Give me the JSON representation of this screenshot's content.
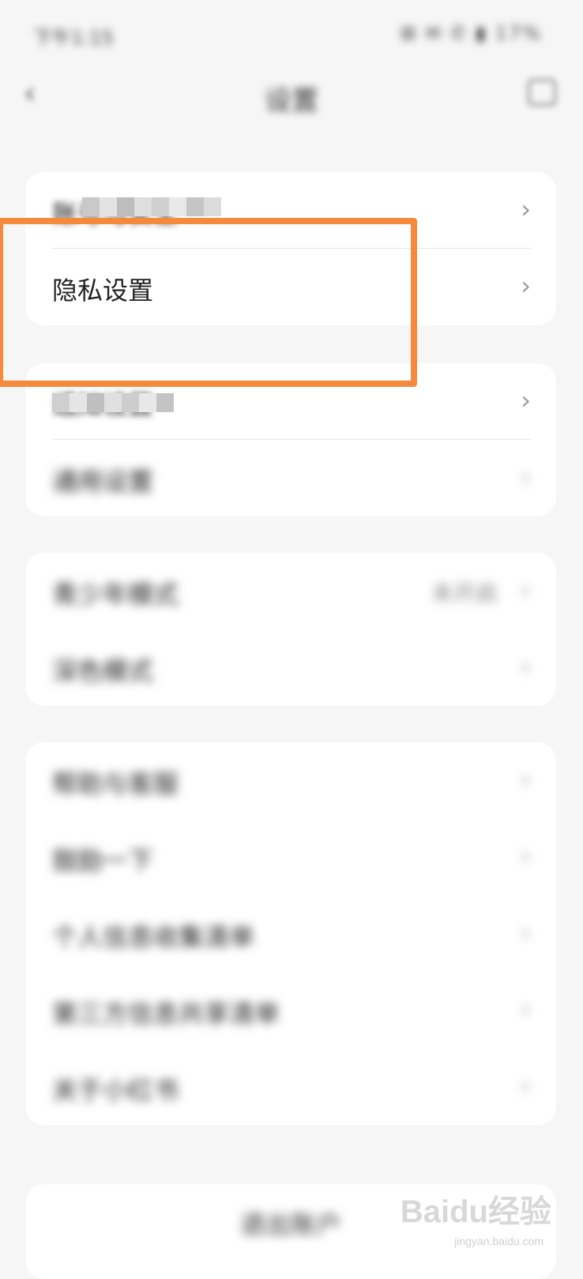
{
  "status_bar": {
    "time": "下午1:15",
    "icons": "⊞ ✉ ✆ ▮ 17%"
  },
  "nav": {
    "back_icon": "‹",
    "title": "设置",
    "more_icon": "more-icon"
  },
  "card1": {
    "rows": [
      {
        "label": "账号与安全",
        "chevron": "›"
      },
      {
        "label": "隐私设置",
        "chevron": "›"
      }
    ]
  },
  "card2": {
    "rows": [
      {
        "label": "通知设置",
        "chevron": "›"
      },
      {
        "label": "通用设置",
        "chevron": "›"
      }
    ]
  },
  "card3": {
    "rows": [
      {
        "label": "青少年模式",
        "value": "未开启",
        "chevron": "›"
      },
      {
        "label": "深色模式",
        "chevron": "›"
      }
    ]
  },
  "card4": {
    "rows": [
      {
        "label": "帮助与客服",
        "chevron": "›"
      },
      {
        "label": "鼓励一下",
        "chevron": "›"
      },
      {
        "label": "个人信息收集清单",
        "chevron": "›"
      },
      {
        "label": "第三方信息共享清单",
        "chevron": "›"
      },
      {
        "label": "关于小红书",
        "chevron": "›"
      }
    ]
  },
  "logout": {
    "label": "退出账户"
  },
  "watermark": {
    "brand": "Baidu经验",
    "url": "jingyan.baidu.com"
  },
  "colors": {
    "highlight": "#f5893c",
    "background": "#f6f6f6",
    "card": "#ffffff"
  }
}
